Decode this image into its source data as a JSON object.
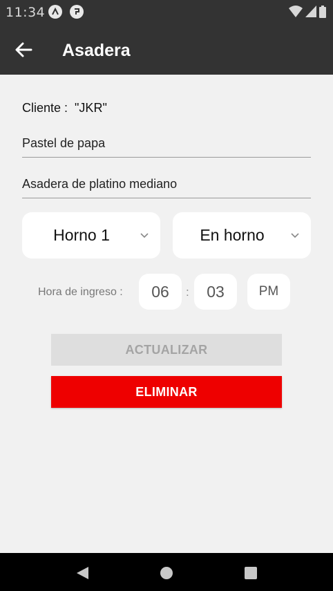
{
  "status_bar": {
    "time": "11:34"
  },
  "header": {
    "title": "Asadera"
  },
  "client": {
    "label": "Cliente :",
    "value": "\"JKR\""
  },
  "fields": {
    "product": "Pastel de papa",
    "tray": "Asadera de platino mediano"
  },
  "pickers": {
    "oven": "Horno 1",
    "state": "En horno"
  },
  "time_entry": {
    "label": "Hora de ingreso :",
    "hour": "06",
    "separator": ":",
    "minute": "03",
    "period": "PM"
  },
  "buttons": {
    "update": "ACTUALIZAR",
    "delete": "ELIMINAR"
  },
  "colors": {
    "header_bg": "#333333",
    "delete_red": "#ee0000",
    "disabled_bg": "#dedede"
  }
}
